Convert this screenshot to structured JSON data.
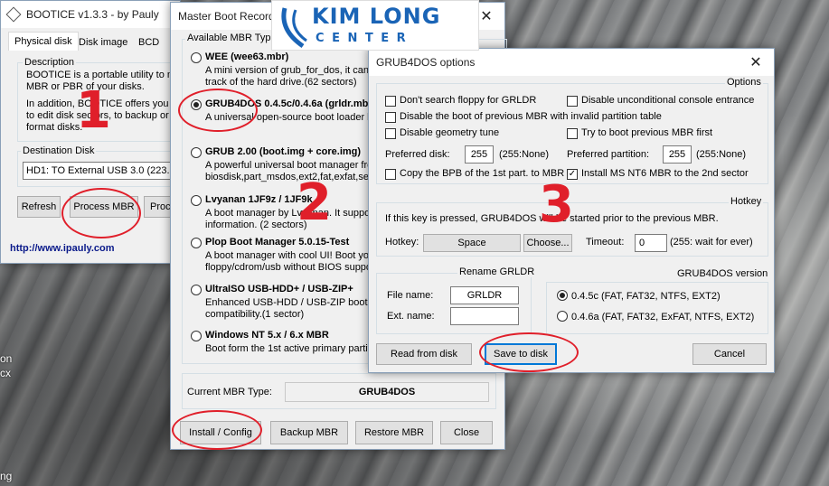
{
  "desktop": {
    "left_text_1": "on",
    "left_text_2": "cx",
    "left_text_3": "ng"
  },
  "bootice": {
    "title": "BOOTICE v1.3.3 - by Pauly",
    "tabs": [
      "Physical disk",
      "Disk image",
      "BCD"
    ],
    "description_title": "Description",
    "description_lines": [
      "BOOTICE is a portable utility to m",
      "MBR or PBR of your disks.",
      "In addition, BOOTICE offers you",
      "to edit disk sectors, to backup or",
      "format disks."
    ],
    "destination_title": "Destination Disk",
    "destination_value": "HD1: TO External USB 3.0 (223.6",
    "buttons": {
      "refresh": "Refresh",
      "process_mbr": "Process MBR",
      "process_pbr": "Proce"
    },
    "link": "http://www.ipauly.com"
  },
  "mbr": {
    "title": "Master Boot Record",
    "group_title": "Available MBR Types",
    "types": [
      {
        "name": "WEE (wee63.mbr)",
        "desc": [
          "A mini version of grub_for_dos, it can",
          "track of the hard drive.(62 sectors)"
        ],
        "selected": false
      },
      {
        "name": "GRUB4DOS 0.4.5c/0.4.6a (grldr.mbr)",
        "desc": [
          "A universal open-source boot loader b"
        ],
        "selected": true
      },
      {
        "name": "GRUB 2.00 (boot.img + core.img)",
        "desc": [
          "A powerful universal boot manager fro",
          "biosdisk,part_msdos,ext2,fat,exfat,se"
        ],
        "selected": false
      },
      {
        "name": "Lvyanan 1JF9z / 1JF9k",
        "desc": [
          "A boot manager by Lvyanan. It suppo",
          "information. (2 sectors)"
        ],
        "selected": false
      },
      {
        "name": "Plop Boot Manager 5.0.15-Test",
        "desc": [
          "A boot manager with cool UI! Boot you",
          "floppy/cdrom/usb without BIOS suppo"
        ],
        "selected": false
      },
      {
        "name": "UltraISO USB-HDD+ / USB-ZIP+",
        "desc": [
          "Enhanced USB-HDD / USB-ZIP boot pro",
          "compatibility.(1 sector)"
        ],
        "selected": false
      },
      {
        "name": "Windows NT 5.x / 6.x MBR",
        "desc": [
          "Boot form the 1st active primary partit"
        ],
        "selected": false
      }
    ],
    "current_label": "Current MBR Type:",
    "current_value": "GRUB4DOS",
    "buttons": {
      "install": "Install / Config",
      "backup": "Backup MBR",
      "restore": "Restore MBR",
      "close": "Close"
    }
  },
  "g4d": {
    "title": "GRUB4DOS options",
    "options_title": "Options",
    "checks": {
      "no_floppy": {
        "label": "Don't search floppy for GRLDR",
        "checked": false
      },
      "unconditional": {
        "label": "Disable unconditional console entrance",
        "checked": false
      },
      "disable_prev": {
        "label": "Disable the boot of previous MBR with invalid partition table",
        "checked": false
      },
      "geometry": {
        "label": "Disable geometry tune",
        "checked": false
      },
      "try_prev": {
        "label": "Try to boot previous MBR first",
        "checked": false
      },
      "copy_bpb": {
        "label": "Copy the BPB of the 1st part. to MBR",
        "checked": false
      },
      "install_nt6": {
        "label": "Install MS NT6 MBR to the 2nd sector",
        "checked": true
      }
    },
    "preferred_disk_label": "Preferred disk:",
    "preferred_disk_value": "255",
    "preferred_disk_note": "(255:None)",
    "preferred_part_label": "Preferred partition:",
    "preferred_part_value": "255",
    "preferred_part_note": "(255:None)",
    "hotkey_title": "Hotkey",
    "hotkey_desc": "If this key is pressed, GRUB4DOS will be started prior to the previous MBR.",
    "hotkey_label": "Hotkey:",
    "hotkey_value": "Space",
    "choose_label": "Choose...",
    "timeout_label": "Timeout:",
    "timeout_value": "0",
    "timeout_note": "(255: wait for ever)",
    "rename_title": "Rename GRLDR",
    "file_name_label": "File name:",
    "file_name_value": "GRLDR",
    "ext_name_label": "Ext. name:",
    "ext_name_value": "",
    "version_title": "GRUB4DOS version",
    "versions": [
      {
        "label": "0.4.5c (FAT, FAT32, NTFS, EXT2)",
        "selected": true
      },
      {
        "label": "0.4.6a (FAT, FAT32, ExFAT, NTFS, EXT2)",
        "selected": false
      }
    ],
    "buttons": {
      "read": "Read from disk",
      "save": "Save to disk",
      "cancel": "Cancel"
    }
  },
  "logo": {
    "line1": "KIM LONG",
    "line2": "C E N T E R"
  },
  "annotations": {
    "n1": "1",
    "n2": "2",
    "n3": "3"
  },
  "colors": {
    "annotation_red": "#e01f2a",
    "logo_blue": "#1a64b6",
    "link_blue": "#0a1a8a"
  }
}
